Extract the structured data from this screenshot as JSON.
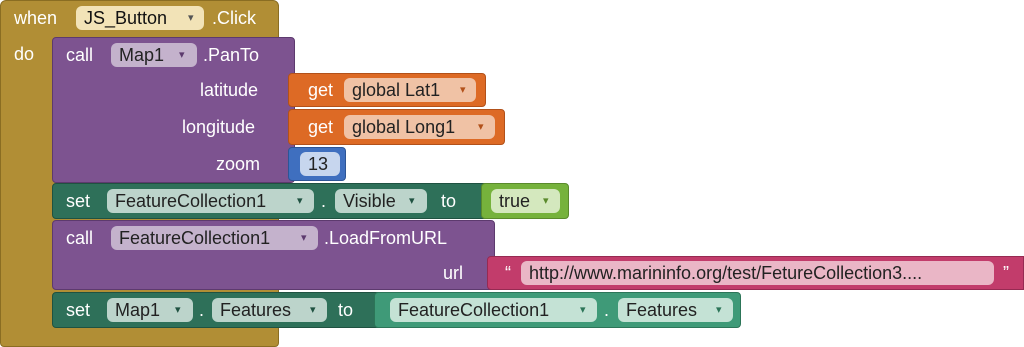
{
  "event": {
    "when": "when",
    "component": "JS_Button",
    "event_name": ".Click",
    "do": "do"
  },
  "pan_to": {
    "call": "call",
    "component": "Map1",
    "method": ".PanTo",
    "arg_latitude": "latitude",
    "arg_longitude": "longitude",
    "arg_zoom": "zoom",
    "lat_get": "get",
    "lat_var": "global Lat1",
    "long_get": "get",
    "long_var": "global Long1",
    "zoom_value": "13"
  },
  "set_visible": {
    "set": "set",
    "component": "FeatureCollection1",
    "dot": ".",
    "property": "Visible",
    "to": "to",
    "value": "true"
  },
  "load_url": {
    "call": "call",
    "component": "FeatureCollection1",
    "method": ".LoadFromURL",
    "arg_url": "url",
    "open_quote": "“",
    "url_value": "http://www.marininfo.org/test/FetureCollection3....",
    "close_quote": "”"
  },
  "set_features": {
    "set": "set",
    "component": "Map1",
    "dot": ".",
    "property": "Features",
    "to": "to",
    "source_component": "FeatureCollection1",
    "source_dot": ".",
    "source_property": "Features"
  },
  "icons": {
    "dropdown": "dropdown-arrow-icon"
  },
  "colors": {
    "event": "#b18e35",
    "procedure": "#7d5390",
    "setter": "#2e7059",
    "variable": "#dd6a25",
    "math": "#3f6fbf",
    "logic": "#76b23c",
    "text": "#c23c6b",
    "component_getter": "#3f9a78"
  }
}
